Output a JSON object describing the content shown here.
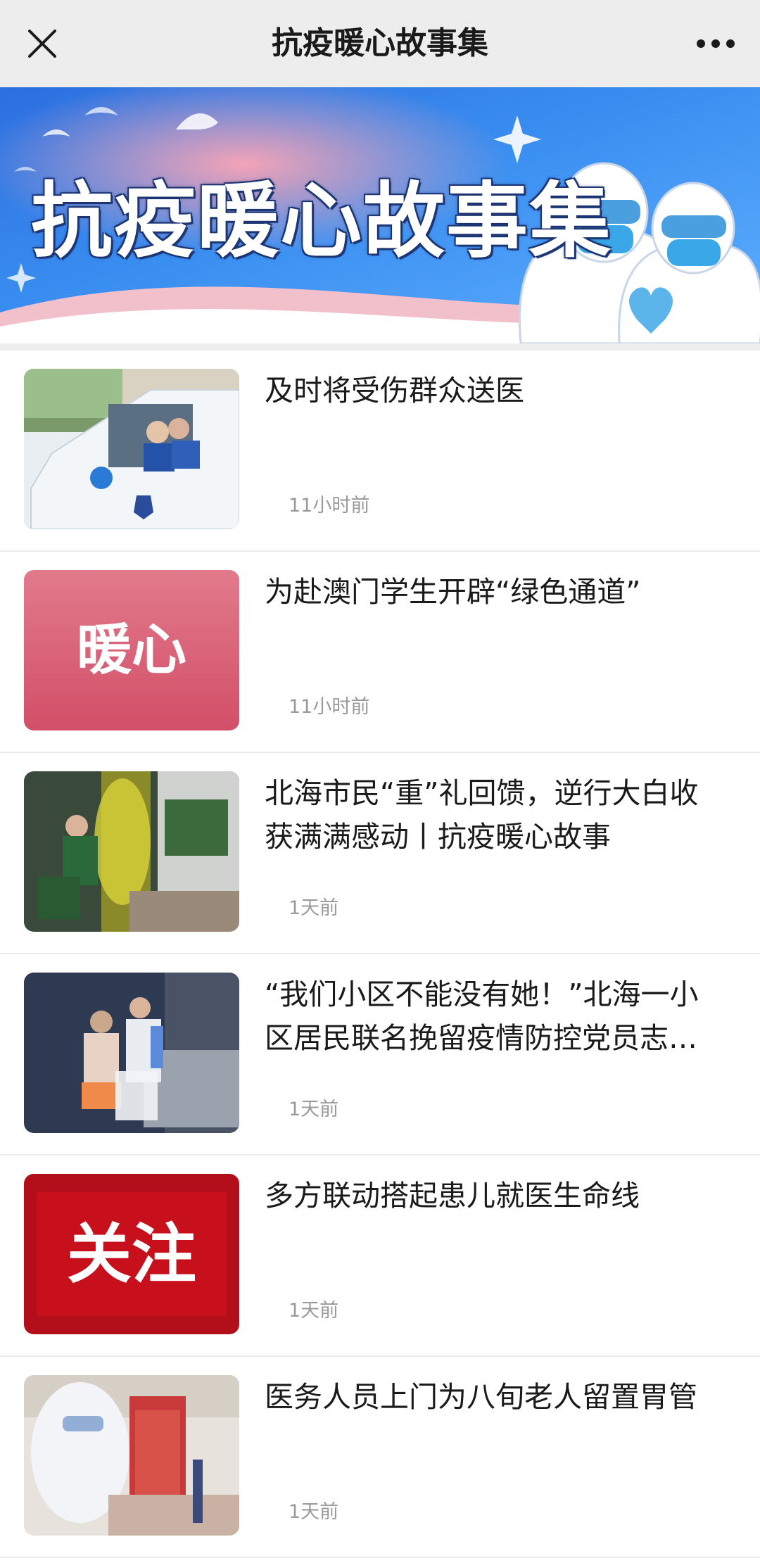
{
  "header": {
    "title": "抗疫暖心故事集",
    "close_icon": "close-icon",
    "more_icon": "more-icon"
  },
  "banner": {
    "text": "抗疫暖心故事集"
  },
  "articles": [
    {
      "title": "及时将受伤群众送医",
      "time": "11小时前"
    },
    {
      "title": "为赴澳门学生开辟“绿色通道”",
      "time": "11小时前",
      "thumb_text": "暖心"
    },
    {
      "title": "北海市民“重”礼回馈，逆行大白收获满满感动丨抗疫暖心故事",
      "time": "1天前"
    },
    {
      "title": "“我们小区不能没有她！”北海一小区居民联名挽留疫情防控党员志愿者",
      "time": "1天前"
    },
    {
      "title": "多方联动搭起患儿就医生命线",
      "time": "1天前",
      "thumb_text": "关注"
    },
    {
      "title": "医务人员上门为八旬老人留置胃管",
      "time": "1天前"
    }
  ],
  "colors": {
    "topbar_bg": "#ededed",
    "banner_blue": "#2f7ee8",
    "warm_pink": "#d9566e",
    "focus_red": "#c8101c"
  }
}
